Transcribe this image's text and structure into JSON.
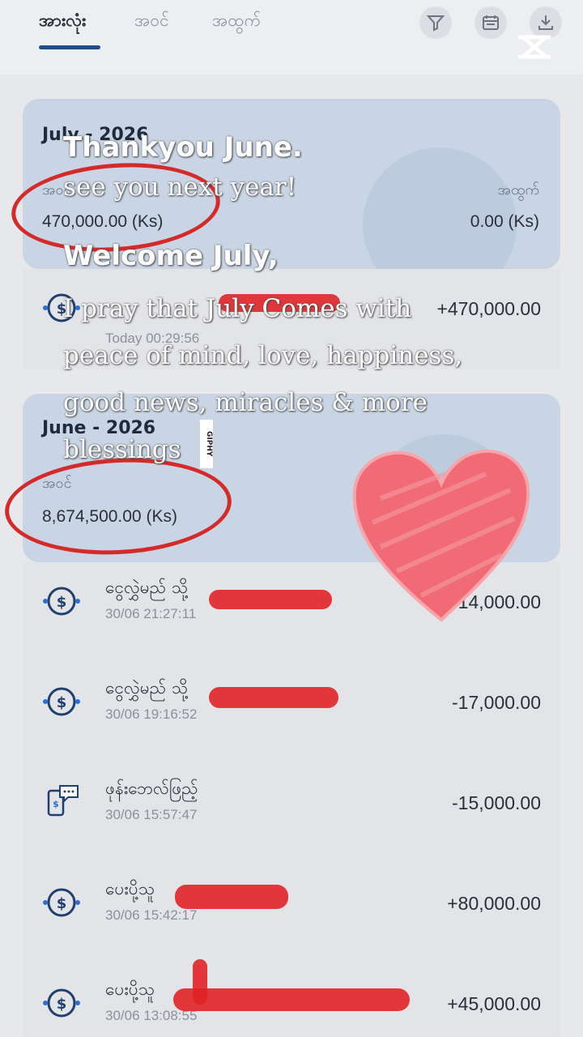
{
  "tabs": [
    "အားလုံး",
    "အဝင်",
    "အထွက်"
  ],
  "icons": {
    "filter": "filter-icon",
    "calendar": "calendar-icon",
    "download": "download-icon"
  },
  "card_july": {
    "month": "July - 2026",
    "income_label": "အဝင်",
    "income": "470,000.00 (Ks)",
    "expense_label": "အထွက်",
    "expense": "0.00 (Ks)"
  },
  "july_txn": {
    "time": "Today 00:29:56",
    "amount": "+470,000.00"
  },
  "card_june": {
    "month": "June - 2026",
    "income_label": "အဝင်",
    "income": "8,674,500.00 (Ks)"
  },
  "transactions": [
    {
      "title": "ငွေလွှဲမည် သို့",
      "time": "30/06 21:27:11",
      "amount": "-14,000.00"
    },
    {
      "title": "ငွေလွှဲမည် သို့",
      "time": "30/06 19:16:52",
      "amount": "-17,000.00"
    },
    {
      "title": "ဖုန်းဘေလ်ဖြည့်",
      "time": "30/06 15:57:47",
      "amount": "-15,000.00"
    },
    {
      "title": "ပေးပို့သူ",
      "time": "30/06 15:42:17",
      "amount": "+80,000.00"
    },
    {
      "title": "ပေးပို့သူ",
      "time": "30/06 13:08:55",
      "amount": "+45,000.00"
    }
  ],
  "overlay": {
    "line1": "Thankyou June.",
    "line2": "see you next year!",
    "line3": "Welcome July,",
    "line4": "I pray that July Comes with",
    "line5": "peace of mind, love, happiness,",
    "line6": "good news, miracles & more",
    "line7": "blessings",
    "giphy": "GIPHY"
  },
  "colors": {
    "tab_underline": "#1f4e8a",
    "annotation_red": "#d42a2a",
    "heart": "#f06b76"
  }
}
